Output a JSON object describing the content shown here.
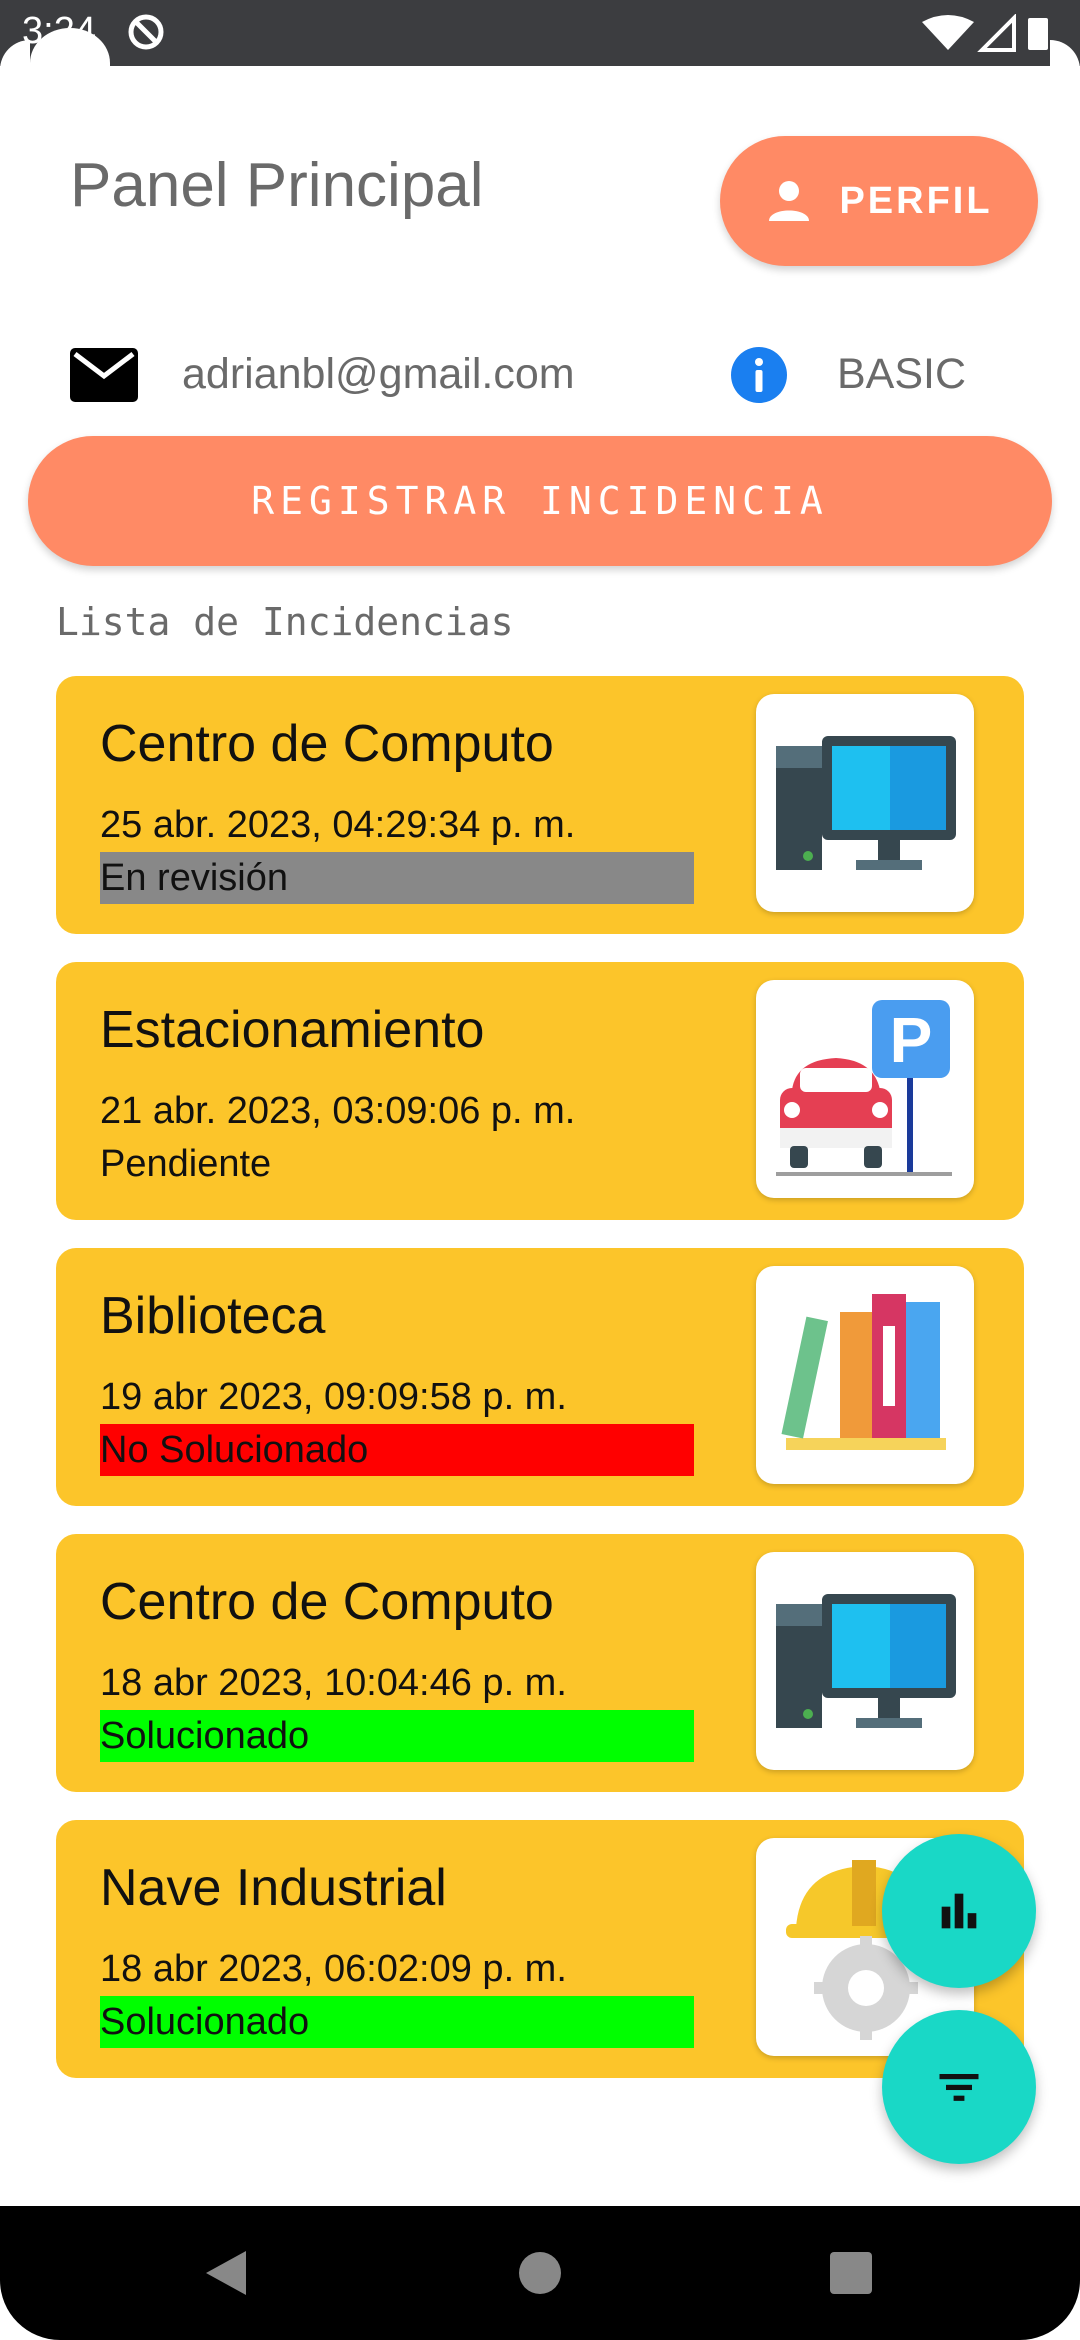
{
  "status_bar": {
    "time": "3:24"
  },
  "header": {
    "title": "Panel Principal",
    "profile_button": "PERFIL"
  },
  "user": {
    "email": "adrianbl@gmail.com",
    "plan": "BASIC"
  },
  "register_button": "REGISTRAR INCIDENCIA",
  "list_title": "Lista de Incidencias",
  "incidents": [
    {
      "place": "Centro de Computo",
      "date": "25 abr. 2023, 04:29:34 p. m.",
      "status": "En revisión",
      "status_color": "#888888",
      "icon": "computer-icon"
    },
    {
      "place": "Estacionamiento",
      "date": "21 abr. 2023, 03:09:06 p. m.",
      "status": "Pendiente",
      "status_color": "transparent",
      "icon": "parking-icon"
    },
    {
      "place": "Biblioteca",
      "date": "19 abr 2023, 09:09:58 p. m.",
      "status": "No Solucionado",
      "status_color": "#ff0000",
      "icon": "books-icon"
    },
    {
      "place": "Centro de Computo",
      "date": "18 abr 2023, 10:04:46 p. m.",
      "status": "Solucionado",
      "status_color": "#00ff00",
      "icon": "computer-icon"
    },
    {
      "place": "Nave Industrial",
      "date": "18 abr 2023, 06:02:09 p. m.",
      "status": "Solucionado",
      "status_color": "#00ff00",
      "icon": "industrial-icon"
    }
  ],
  "fabs": [
    {
      "icon": "bar-chart-icon"
    },
    {
      "icon": "filter-icon"
    }
  ],
  "colors": {
    "accent": "#ff8a65",
    "card": "#fcc52a",
    "fab": "#19d8c6"
  }
}
